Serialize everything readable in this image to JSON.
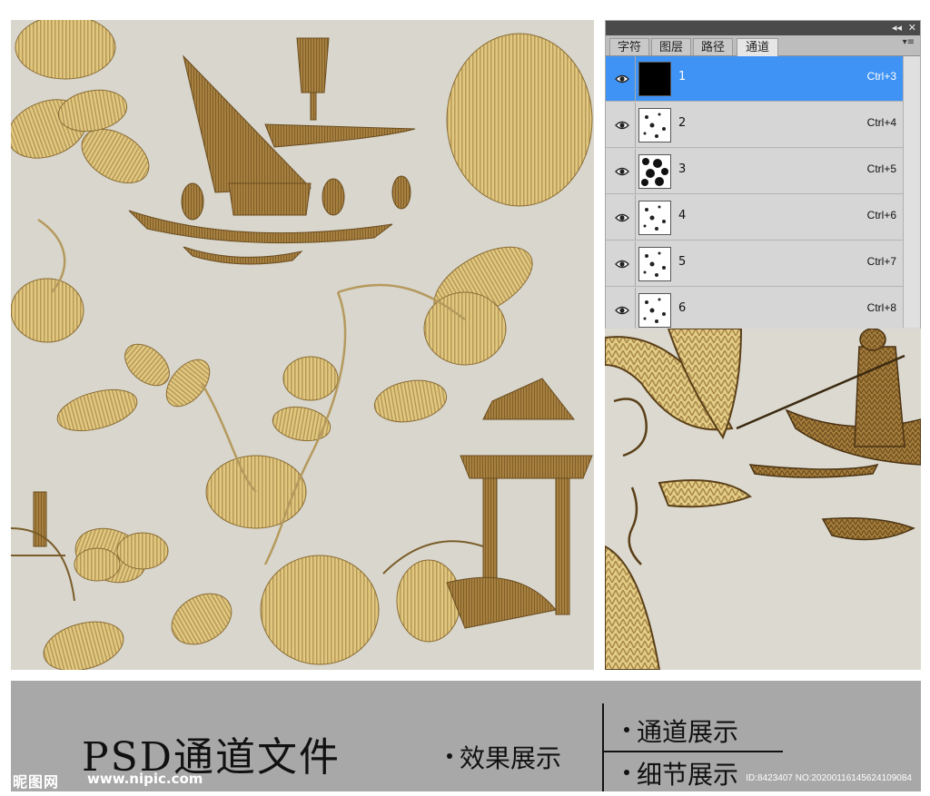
{
  "panel": {
    "tabs": [
      {
        "label": "字符",
        "active": false
      },
      {
        "label": "图层",
        "active": false
      },
      {
        "label": "路径",
        "active": false
      },
      {
        "label": "通道",
        "active": true
      }
    ],
    "collapse_glyph": "◂◂",
    "close_glyph": "✕",
    "menu_glyph": "▾≡",
    "channels": [
      {
        "name": "1",
        "shortcut": "Ctrl+3",
        "selected": true,
        "thumb": "black"
      },
      {
        "name": "2",
        "shortcut": "Ctrl+4",
        "selected": false,
        "thumb": "sparse"
      },
      {
        "name": "3",
        "shortcut": "Ctrl+5",
        "selected": false,
        "thumb": "dense"
      },
      {
        "name": "4",
        "shortcut": "Ctrl+6",
        "selected": false,
        "thumb": "sparse"
      },
      {
        "name": "5",
        "shortcut": "Ctrl+7",
        "selected": false,
        "thumb": "sparse"
      },
      {
        "name": "6",
        "shortcut": "Ctrl+8",
        "selected": false,
        "thumb": "sparse"
      }
    ],
    "icons": {
      "visibility": "eye-icon"
    }
  },
  "footer": {
    "title": "PSD通道文件",
    "label_effect": "效果展示",
    "label_channel": "通道展示",
    "label_detail": "细节展示"
  },
  "watermark": {
    "logo": "昵图网",
    "url": "www.nipic.com",
    "id": "ID:8423407 NO:20200116145624109084"
  },
  "colors": {
    "background": "#d9d6cd",
    "gold": "#d8be72",
    "bronze": "#9a7438",
    "selection": "#3f93f5",
    "banner": "#a8a8a8"
  }
}
